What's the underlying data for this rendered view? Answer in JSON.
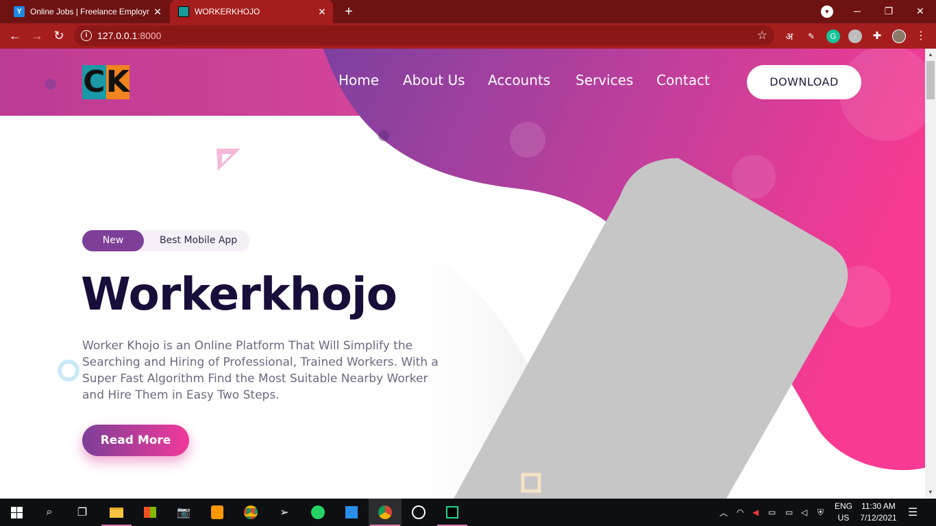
{
  "browser": {
    "tabs": [
      {
        "title": "Online Jobs | Freelance Employm",
        "favicon": "Y"
      },
      {
        "title": "WORKERKHOJO",
        "favicon": "CK"
      }
    ],
    "url_host": "127.0.0.1",
    "url_port": ":8000",
    "ext_hindi": "अ"
  },
  "site": {
    "logo_c": "C",
    "logo_k": "K",
    "nav": [
      "Home",
      "About Us",
      "Accounts",
      "Services",
      "Contact"
    ],
    "download_label": "DOWNLOAD",
    "badge_new": "New",
    "badge_text": "Best Mobile App",
    "headline": "Workerkhojo",
    "description": "Worker Khojo is an Online Platform That Will Simplify the Searching and Hiring of Professional, Trained Workers. With a Super Fast Algorithm Find the Most Suitable Nearby Worker and Hire Them in Easy Two Steps.",
    "read_more": "Read More",
    "colors": {
      "purple": "#7d3f98",
      "pink": "#f2399a",
      "dark": "#190d3a"
    }
  },
  "taskbar": {
    "lang_top": "ENG",
    "lang_bottom": "US",
    "time": "11:30 AM",
    "date": "7/12/2021"
  }
}
